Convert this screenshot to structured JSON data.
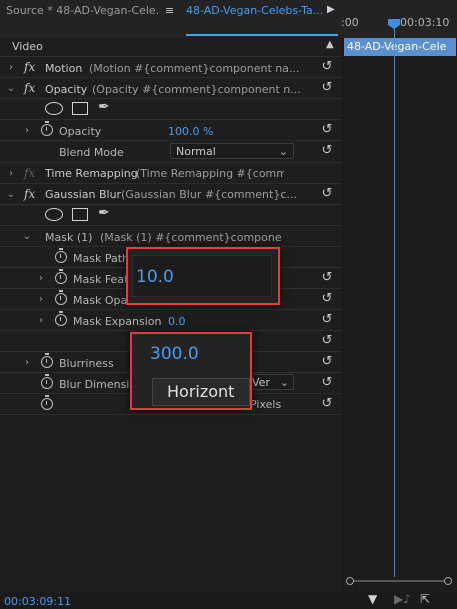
{
  "tabs": {
    "source": "Source * 48-AD-Vegan-Cele...",
    "effect_controls": "48-AD-Vegan-Celebs-Ta...",
    "menu_icon": "hamburger-menu-icon"
  },
  "ruler": {
    "time_start": ":00",
    "time_mark": "00:03:10"
  },
  "section_header": "Video",
  "clip_label": "48-AD-Vegan-Cele",
  "effects": {
    "motion": {
      "name": "Motion",
      "desc": "(Motion  #{comment}component na..."
    },
    "opacity": {
      "name": "Opacity",
      "desc": "(Opacity  #{comment}component n...",
      "opacity_label": "Opacity",
      "opacity_value": "100.0 %",
      "blend_label": "Blend Mode",
      "blend_value": "Normal"
    },
    "time_remap": {
      "name": "Time Remapping",
      "desc": "(Time Remapping  #{comm..."
    },
    "gaussian": {
      "name": "Gaussian Blur",
      "desc": "(Gaussian Blur  #{comment}c...",
      "mask_name": "Mask (1)",
      "mask_desc": "(Mask (1)  #{comment}component ...",
      "mask_path": "Mask Path",
      "mask_feather": "Mask Feat",
      "mask_opacity": "Mask Opac",
      "mask_expansion": "Mask Expansion",
      "mask_expansion_value": "0.0",
      "blurriness": "Blurriness",
      "blur_dimensions": "Blur Dimension",
      "blur_dim_value": "Ver",
      "repeat_edge": "Pixels"
    }
  },
  "callouts": {
    "feather_value": "10.0",
    "blurriness_value": "300.0",
    "dimension_value": "Horizont"
  },
  "footer": {
    "timecode": "00:03:09:11"
  },
  "colors": {
    "accent": "#4a9be8",
    "callout_border": "#e83a3a",
    "clip": "#5a8fd0"
  }
}
